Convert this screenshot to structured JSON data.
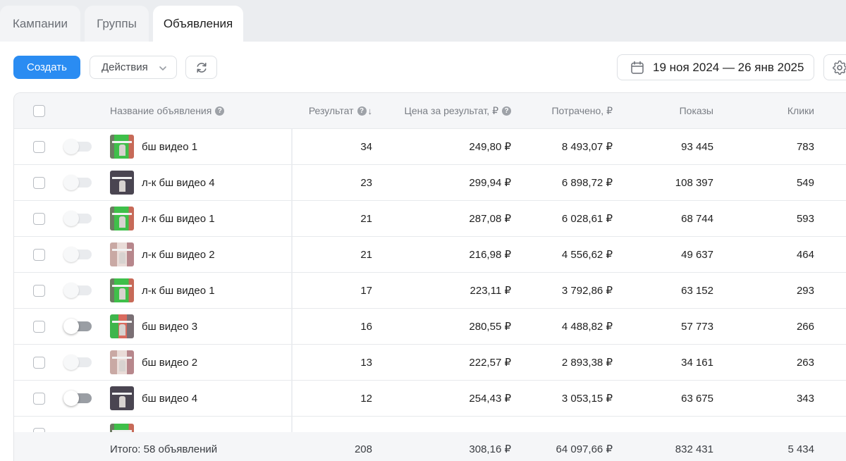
{
  "tabs": [
    {
      "label": "Кампании",
      "active": false
    },
    {
      "label": "Группы",
      "active": false
    },
    {
      "label": "Объявления",
      "active": true
    }
  ],
  "toolbar": {
    "create_label": "Создать",
    "actions_label": "Действия",
    "date_range": "19 ноя 2024 — 26 янв 2025"
  },
  "table": {
    "columns": {
      "name": "Название объявления",
      "result": "Результат",
      "price": "Цена за результат, ₽",
      "spent": "Потрачено, ₽",
      "shows": "Показы",
      "clicks": "Клики"
    },
    "rows": [
      {
        "name": "бш видео 1",
        "result": "34",
        "price": "249,80 ₽",
        "spent": "8 493,07 ₽",
        "shows": "93 445",
        "clicks": "783",
        "toggle": "light",
        "thumb": "green"
      },
      {
        "name": "л-к бш видео 4",
        "result": "23",
        "price": "299,94 ₽",
        "spent": "6 898,72 ₽",
        "shows": "108 397",
        "clicks": "549",
        "toggle": "light",
        "thumb": "dark"
      },
      {
        "name": "л-к бш видео 1",
        "result": "21",
        "price": "287,08 ₽",
        "spent": "6 028,61 ₽",
        "shows": "68 744",
        "clicks": "593",
        "toggle": "light",
        "thumb": "green"
      },
      {
        "name": "л-к бш видео 2",
        "result": "21",
        "price": "216,98 ₽",
        "spent": "4 556,62 ₽",
        "shows": "49 637",
        "clicks": "464",
        "toggle": "light",
        "thumb": "pink"
      },
      {
        "name": "л-к бш видео 1",
        "result": "17",
        "price": "223,11 ₽",
        "spent": "3 792,86 ₽",
        "shows": "63 152",
        "clicks": "293",
        "toggle": "light",
        "thumb": "green"
      },
      {
        "name": "бш видео 3",
        "result": "16",
        "price": "280,55 ₽",
        "spent": "4 488,82 ₽",
        "shows": "57 773",
        "clicks": "266",
        "toggle": "dark",
        "thumb": "mixed"
      },
      {
        "name": "бш видео 2",
        "result": "13",
        "price": "222,57 ₽",
        "spent": "2 893,38 ₽",
        "shows": "34 161",
        "clicks": "263",
        "toggle": "light",
        "thumb": "pink"
      },
      {
        "name": "бш видео 4",
        "result": "12",
        "price": "254,43 ₽",
        "spent": "3 053,15 ₽",
        "shows": "63 675",
        "clicks": "343",
        "toggle": "dark",
        "thumb": "dark"
      }
    ],
    "totals": {
      "label": "Итого: 58 объявлений",
      "result": "208",
      "price": "308,16 ₽",
      "spent": "64 097,66 ₽",
      "shows": "832 431",
      "clicks": "5 434"
    }
  },
  "colors": {
    "primary": "#2a8cf2",
    "tab_bar_bg": "#ebedf0",
    "header_bg": "#f5f6f8"
  }
}
